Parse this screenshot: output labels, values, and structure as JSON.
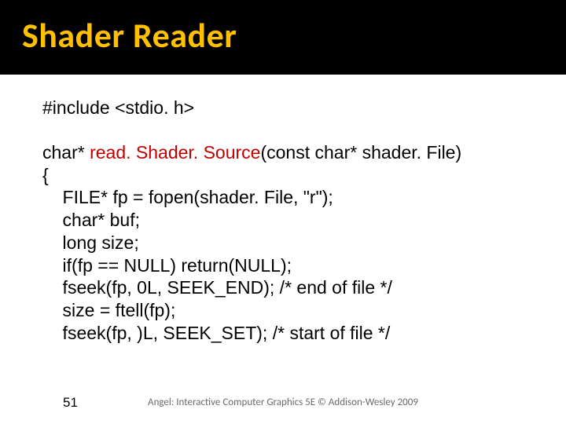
{
  "title": "Shader Reader",
  "code": {
    "l1": "#include <stdio. h>",
    "l2a": "char* ",
    "l2b": "read. Shader. Source",
    "l2c": "(const char* shader. File)",
    "l3": "{",
    "l4": "    FILE* fp = fopen(shader. File, \"r\");",
    "l5": "    char* buf;",
    "l6": "    long size;",
    "l7": "    if(fp == NULL) return(NULL);",
    "l8": "    fseek(fp, 0L, SEEK_END); /* end of file */",
    "l9": "    size = ftell(fp);",
    "l10": "    fseek(fp, )L, SEEK_SET); /* start of file */"
  },
  "footer": {
    "slide_number": "51",
    "attribution": "Angel: Interactive Computer Graphics 5E © Addison-Wesley 2009"
  }
}
